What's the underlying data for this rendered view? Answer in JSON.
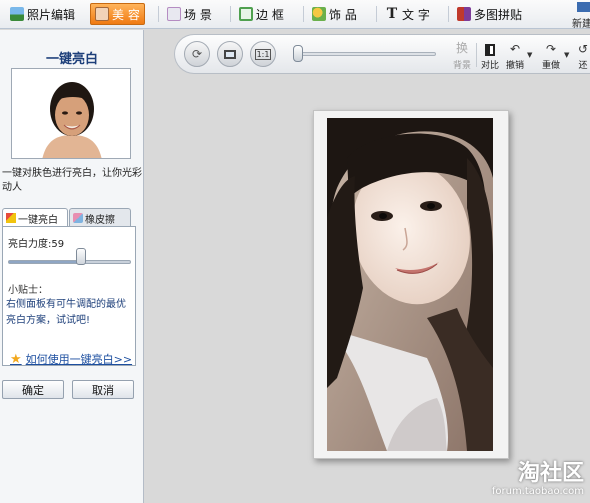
{
  "topnav": {
    "items": [
      {
        "label": "照片编辑",
        "icon": "landscape-icon"
      },
      {
        "label": "美 容",
        "icon": "face-icon",
        "active": true
      },
      {
        "label": "场 景",
        "icon": "scene-icon"
      },
      {
        "label": "边 框",
        "icon": "frame-icon"
      },
      {
        "label": "饰 品",
        "icon": "ornament-icon"
      },
      {
        "label": "文 字",
        "icon": "text-icon",
        "glyph": "T"
      },
      {
        "label": "多图拼贴",
        "icon": "collage-icon"
      }
    ],
    "new_label": "新建"
  },
  "left_panel": {
    "title": "一键亮白",
    "description": "一键对肤色进行亮白，让你光彩动人",
    "tabs": [
      "一键亮白",
      "橡皮擦"
    ],
    "intensity_label": "亮白力度:59",
    "intensity_value": 59,
    "intensity_max": 100,
    "tips_title": "小贴士：",
    "tips_body": "右侧面板有可牛调配的最优亮白方案，试试吧!",
    "help_link": "如何使用一键亮白>>",
    "ok_button": "确定",
    "cancel_button": "取消"
  },
  "toolbar": {
    "swap_label": "换",
    "swap_label2": "背景",
    "compare_label": "对比",
    "undo_label": "撤销",
    "redo_label": "重做",
    "restore_label": "还"
  },
  "watermark": {
    "logo_text": "淘社区",
    "url": "forum.taobao.com"
  },
  "colors": {
    "accent": "#f07a12",
    "link": "#1d4fa0",
    "title": "#1d3f7a"
  }
}
